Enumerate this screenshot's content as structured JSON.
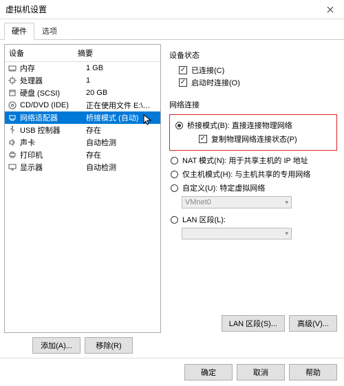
{
  "window": {
    "title": "虚拟机设置"
  },
  "tabs": {
    "hardware": "硬件",
    "options": "选项"
  },
  "list": {
    "col1": "设备",
    "col2": "摘要",
    "rows": [
      {
        "icon": "memory",
        "name": "内存",
        "summary": "1 GB"
      },
      {
        "icon": "cpu",
        "name": "处理器",
        "summary": "1"
      },
      {
        "icon": "disk",
        "name": "硬盘 (SCSI)",
        "summary": "20 GB"
      },
      {
        "icon": "cd",
        "name": "CD/DVD (IDE)",
        "summary": "正在使用文件 E:\\迅雷下载\\C..."
      },
      {
        "icon": "network",
        "name": "网络适配器",
        "summary": "桥接模式 (自动)",
        "selected": true
      },
      {
        "icon": "usb",
        "name": "USB 控制器",
        "summary": "存在"
      },
      {
        "icon": "sound",
        "name": "声卡",
        "summary": "自动检测"
      },
      {
        "icon": "printer",
        "name": "打印机",
        "summary": "存在"
      },
      {
        "icon": "display",
        "name": "显示器",
        "summary": "自动检测"
      }
    ]
  },
  "left_buttons": {
    "add": "添加(A)...",
    "remove": "移除(R)"
  },
  "device_status": {
    "title": "设备状态",
    "connected": "已连接(C)",
    "connect_at_on": "启动时连接(O)"
  },
  "network": {
    "title": "网络连接",
    "bridge": "桥接模式(B): 直接连接物理网络",
    "replicate": "复制物理网络连接状态(P)",
    "nat": "NAT 模式(N): 用于共享主机的 IP 地址",
    "hostonly": "仅主机模式(H): 与主机共享的专用网络",
    "custom": "自定义(U): 特定虚拟网络",
    "custom_value": "VMnet0",
    "lan": "LAN 区段(L):"
  },
  "right_buttons": {
    "lan_seg": "LAN 区段(S)...",
    "advanced": "高级(V)..."
  },
  "footer": {
    "ok": "确定",
    "cancel": "取消",
    "help": "帮助"
  }
}
